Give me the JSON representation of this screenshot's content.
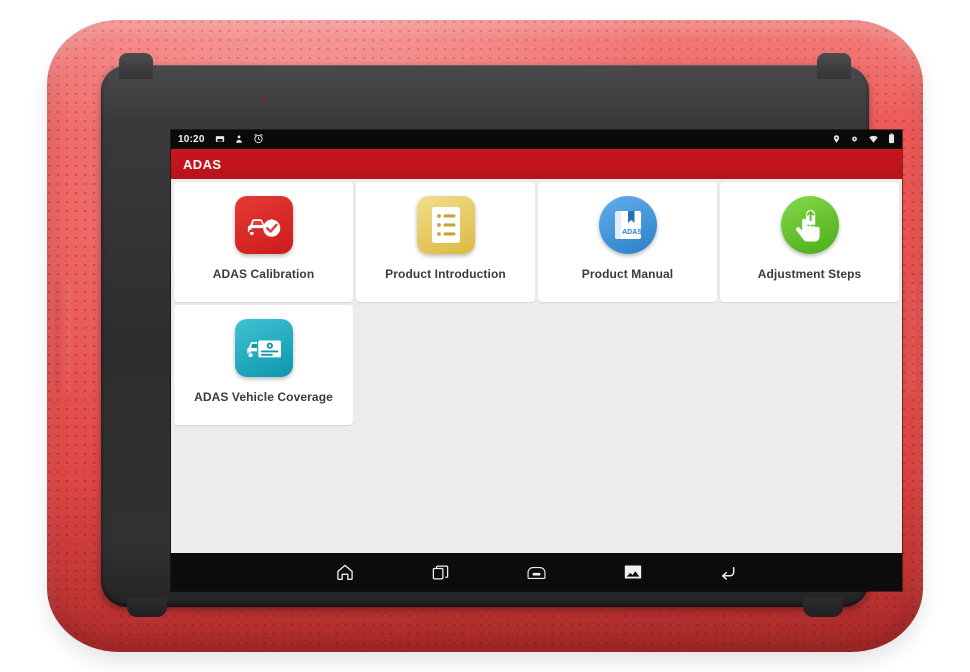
{
  "device": {
    "name": "ADAS diagnostic tablet",
    "bumper_color": "#e85250",
    "chassis_color": "#2e2e30"
  },
  "status_bar": {
    "time": "10:20",
    "left_icons": [
      "sd-card-icon",
      "person-icon",
      "alarm-mute-icon"
    ],
    "right_icons": [
      "location-icon",
      "bluetooth-icon",
      "wifi-icon",
      "battery-icon"
    ],
    "background": "#0a0a0a"
  },
  "app_bar": {
    "title": "ADAS",
    "background": "#c1141c"
  },
  "content": {
    "background": "#ececec",
    "tiles": [
      {
        "label": "ADAS Calibration",
        "icon": "car-calibration-icon",
        "icon_shape": "rounded-square",
        "color": "#d32121"
      },
      {
        "label": "Product Introduction",
        "icon": "document-list-icon",
        "icon_shape": "rounded-square",
        "color": "#e8c85a"
      },
      {
        "label": "Product Manual",
        "icon": "adas-book-icon",
        "icon_shape": "circle",
        "color": "#3a8fdc",
        "book_text": "ADAS"
      },
      {
        "label": "Adjustment Steps",
        "icon": "hand-tap-icon",
        "icon_shape": "circle",
        "color": "#5cc523"
      },
      {
        "label": "ADAS Vehicle Coverage",
        "icon": "car-document-icon",
        "icon_shape": "rounded-square",
        "color": "#16a8bd"
      }
    ]
  },
  "nav_bar": {
    "background": "#0c0c0c",
    "buttons": [
      {
        "name": "home",
        "icon": "home-icon"
      },
      {
        "name": "recents",
        "icon": "recent-apps-icon"
      },
      {
        "name": "vci",
        "icon": "obd-connector-icon"
      },
      {
        "name": "screenshot",
        "icon": "image-icon"
      },
      {
        "name": "back",
        "icon": "back-arrow-icon"
      }
    ]
  }
}
